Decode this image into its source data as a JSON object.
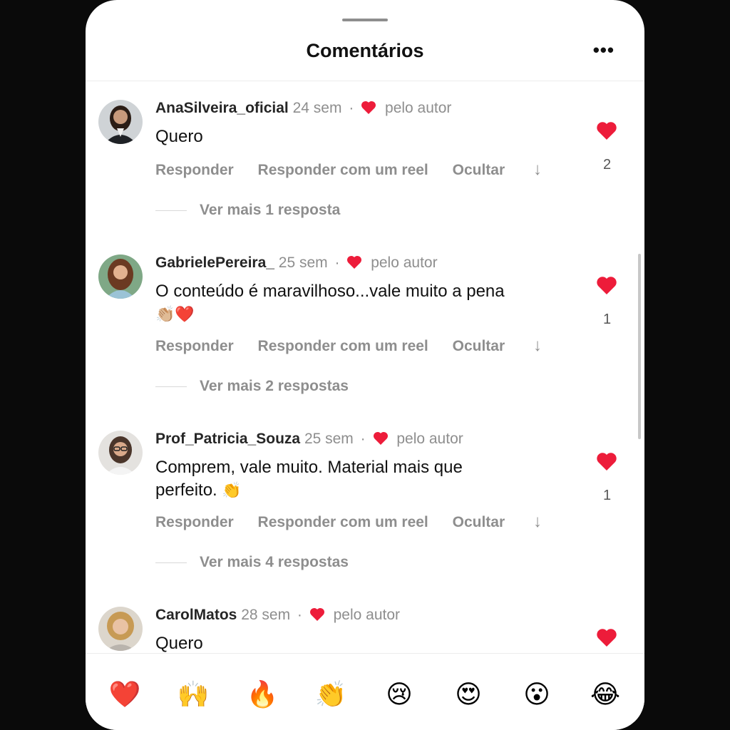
{
  "header": {
    "title": "Comentários",
    "more_label": "•••"
  },
  "comments": [
    {
      "username": "AnaSilveira_oficial",
      "time": "24 sem",
      "liked_by_author": "pelo autor",
      "text": "Quero",
      "emoji": "",
      "actions": {
        "reply": "Responder",
        "reply_reel": "Responder com um reel",
        "hide": "Ocultar",
        "arrow": "↓"
      },
      "likes": "2",
      "view_replies": "Ver mais 1 resposta"
    },
    {
      "username": "GabrielePereira_",
      "time": "25 sem",
      "liked_by_author": "pelo autor",
      "text": "O conteúdo é maravilhoso...vale muito a pena",
      "emoji": "👏🏼❤️",
      "actions": {
        "reply": "Responder",
        "reply_reel": "Responder com um reel",
        "hide": "Ocultar",
        "arrow": "↓"
      },
      "likes": "1",
      "view_replies": "Ver mais 2 respostas"
    },
    {
      "username": "Prof_Patricia_Souza",
      "time": "25 sem",
      "liked_by_author": "pelo autor",
      "text": "Comprem, vale muito. Material mais que perfeito.",
      "emoji": "👏",
      "actions": {
        "reply": "Responder",
        "reply_reel": "Responder com um reel",
        "hide": "Ocultar",
        "arrow": "↓"
      },
      "likes": "1",
      "view_replies": "Ver mais 4 respostas"
    },
    {
      "username": "CarolMatos",
      "time": "28 sem",
      "liked_by_author": "pelo autor",
      "text": "Quero",
      "emoji": ""
    }
  ],
  "emoji_bar": [
    "❤️",
    "🙌",
    "🔥",
    "👏",
    "😢",
    "😍",
    "😮",
    "😂"
  ],
  "colors": {
    "heart": "#ed1c3a",
    "muted_text": "#8e8e8e",
    "background": "#0a0a0a"
  }
}
